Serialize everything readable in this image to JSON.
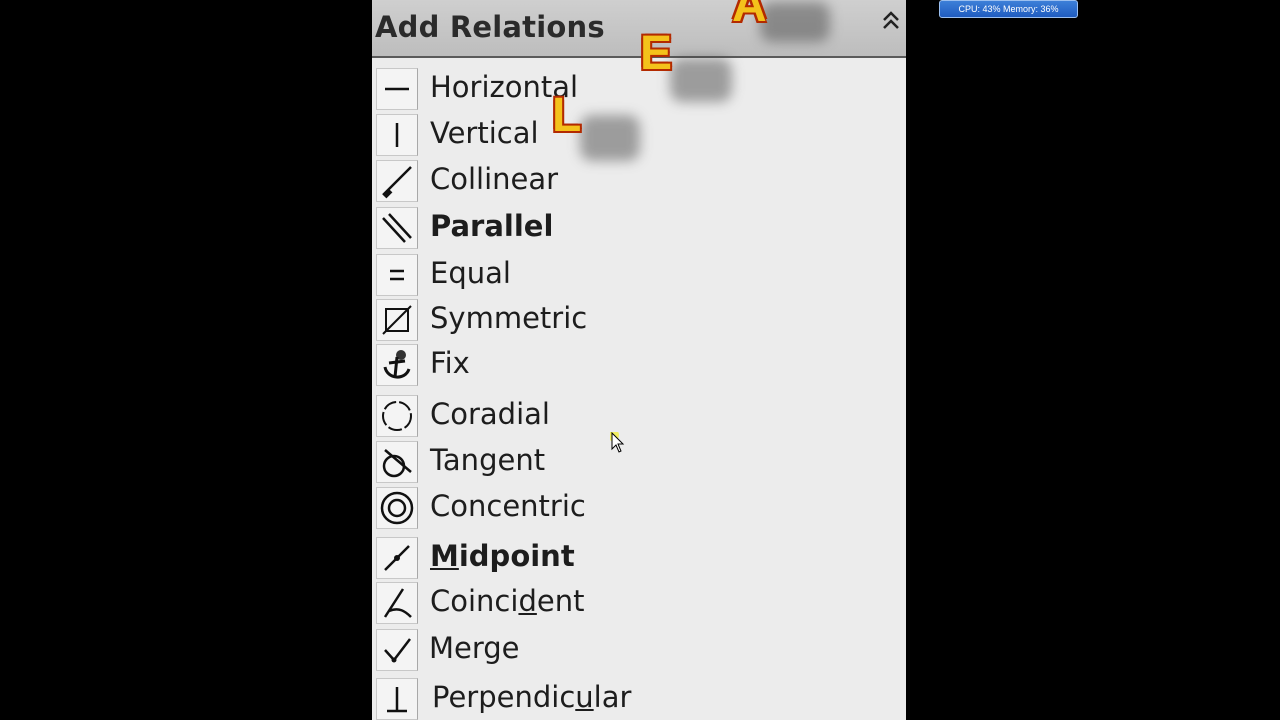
{
  "panel": {
    "title": "Add Relations",
    "items": [
      {
        "label": "Horizontal",
        "icon": "horizontal-line-icon"
      },
      {
        "label": "Vertical",
        "icon": "vertical-line-icon"
      },
      {
        "label": "Collinear",
        "icon": "collinear-icon"
      },
      {
        "label": "Parallel",
        "icon": "parallel-icon",
        "bold": true
      },
      {
        "label": "Equal",
        "icon": "equal-icon"
      },
      {
        "label": "Symmetric",
        "icon": "symmetric-icon"
      },
      {
        "label": "Fix",
        "icon": "anchor-icon"
      },
      {
        "label": "Coradial",
        "icon": "coradial-icon"
      },
      {
        "label": "Tangent",
        "icon": "tangent-icon"
      },
      {
        "label": "Concentric",
        "icon": "concentric-icon"
      },
      {
        "label_pre": "",
        "label_ul": "M",
        "label_post": "idpoint",
        "label": "Midpoint",
        "icon": "midpoint-icon",
        "bold": true
      },
      {
        "label_pre": "Coinci",
        "label_ul": "d",
        "label_post": "ent",
        "label": "Coincident",
        "icon": "coincident-icon"
      },
      {
        "label": "Merge",
        "icon": "merge-icon"
      },
      {
        "label_pre": "Perpendic",
        "label_ul": "u",
        "label_post": "lar",
        "label": "Perpendicular",
        "icon": "perpendicular-icon"
      }
    ]
  },
  "overlay_letters": [
    "A",
    "E",
    "L"
  ],
  "system_monitor": {
    "text": "CPU: 43%  Memory: 36%"
  },
  "colors": {
    "accent_letter": "#f4c21b",
    "letter_outline": "#b32a00",
    "monitor_blue": "#1f5cc0"
  }
}
